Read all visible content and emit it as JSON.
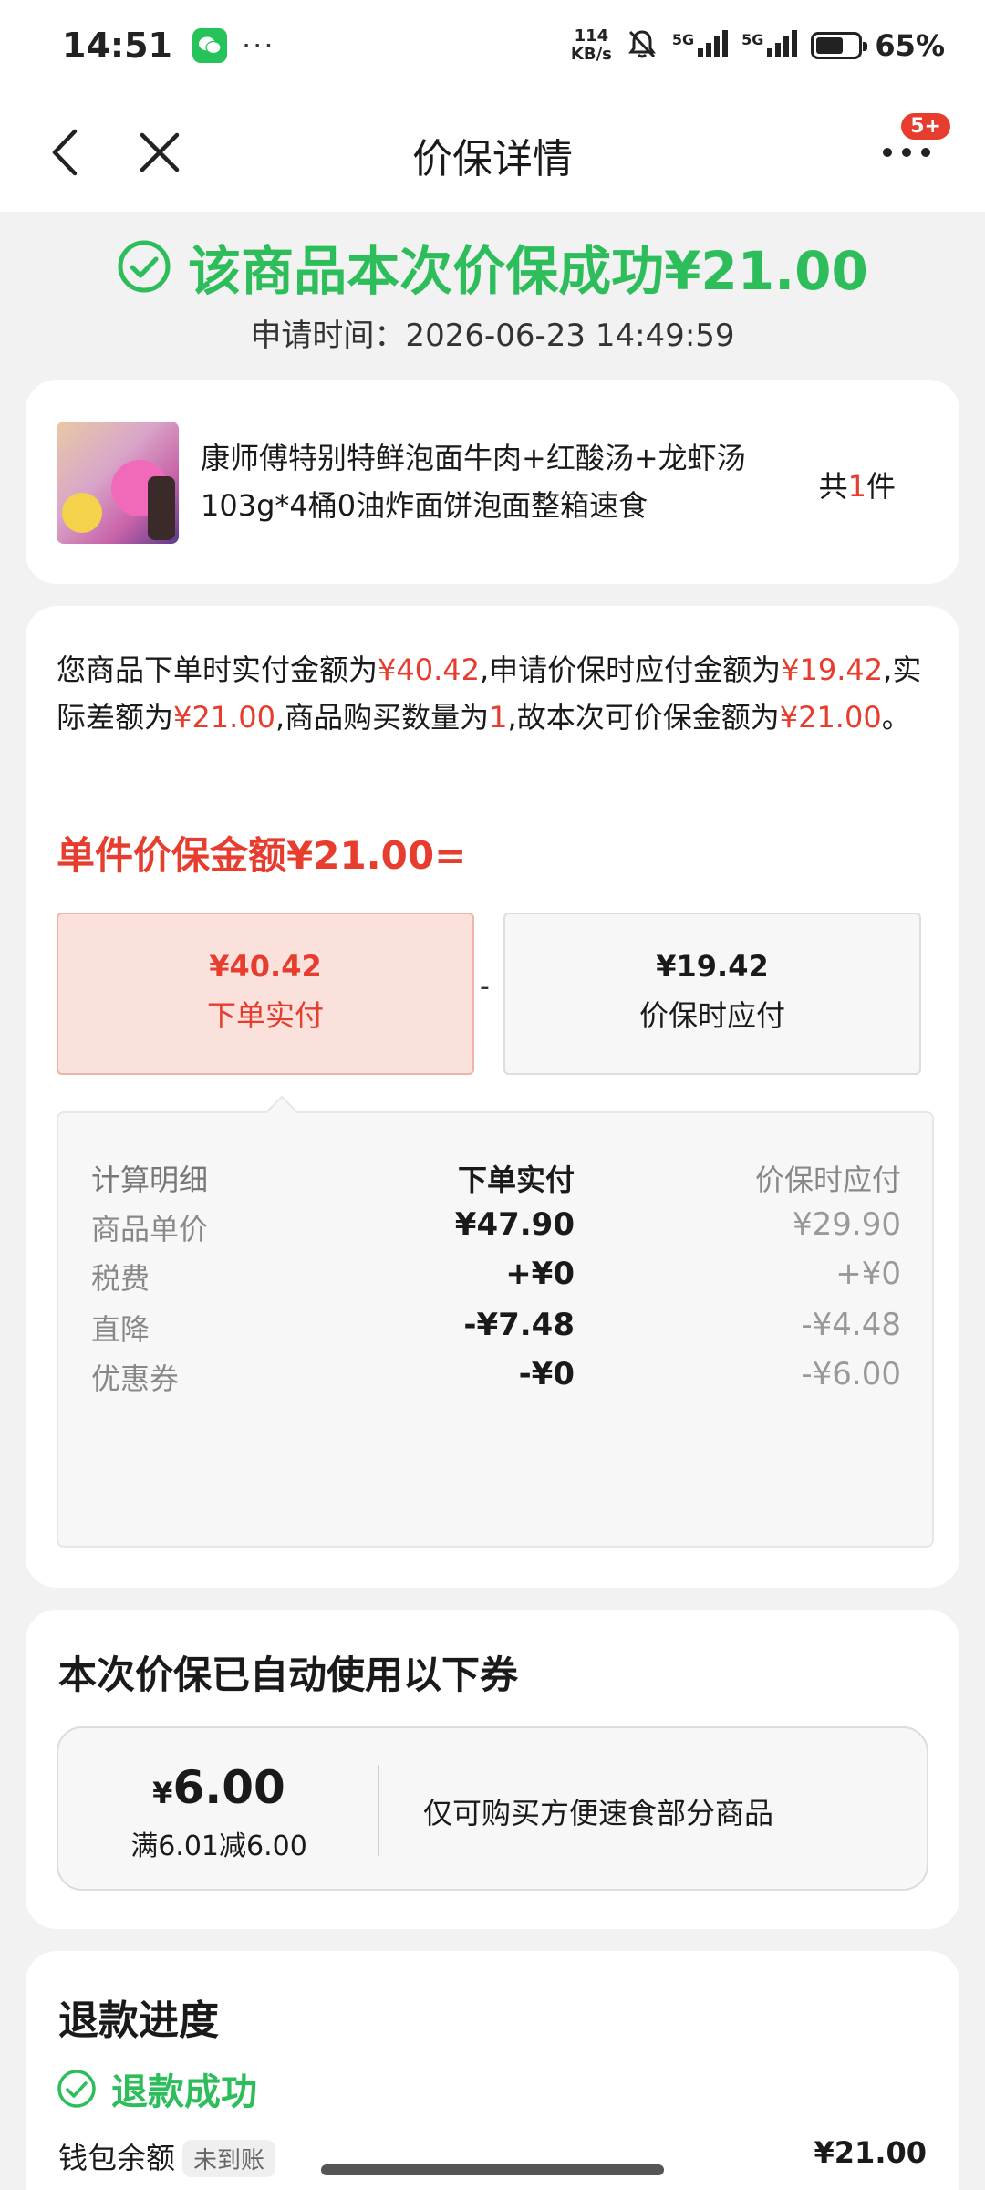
{
  "status_bar": {
    "time": "14:51",
    "more": "···",
    "net_speed_value": "114",
    "net_speed_unit": "KB/s",
    "signal1": "5G",
    "signal2": "5G",
    "battery_level": 0.65,
    "battery": "65%"
  },
  "nav": {
    "title": "价保详情",
    "badge": "5+"
  },
  "header": {
    "success": "该商品本次价保成功¥21.00",
    "apply_time": "申请时间：2026-06-23 14:49:59"
  },
  "product": {
    "name": "康师傅特别特鲜泡面牛肉+红酸汤+龙虾汤103g*4桶0油炸面饼泡面整箱速食",
    "qty_prefix": "共",
    "qty": "1",
    "qty_suffix": "件"
  },
  "detail": {
    "desc_1": "您商品下单时实付金额为",
    "paid": "¥40.42",
    "desc_2": ",申请价保时应付金额为",
    "protect_pay": "¥19.42",
    "desc_3": ",实际差额为",
    "diff": "¥21.00",
    "desc_4": ",商品购买数量为",
    "qty": "1",
    "desc_5": ",故本次可价保金额为",
    "total": "¥21.00",
    "desc_6": "。",
    "unit_title": "单件价保金额¥21.00=",
    "box_pay_amount": "¥40.42",
    "box_pay_label": "下单实付",
    "minus": "-",
    "box_protect_amount": "¥19.42",
    "box_protect_label": "价保时应付",
    "calc_headers": [
      "计算明细",
      "下单实付",
      "价保时应付"
    ],
    "calc_rows": [
      [
        "商品单价",
        "¥47.90",
        "¥29.90"
      ],
      [
        "税费",
        "+¥0",
        "+¥0"
      ],
      [
        "直降",
        "-¥7.48",
        "-¥4.48"
      ],
      [
        "优惠券",
        "-¥0",
        "-¥6.00"
      ]
    ]
  },
  "coupon": {
    "title": "本次价保已自动使用以下券",
    "yen": "¥",
    "amount": "6.00",
    "condition": "满6.01减6.00",
    "desc": "仅可购买方便速食部分商品"
  },
  "refund": {
    "title": "退款进度",
    "status": "退款成功",
    "row_label": "钱包余额",
    "row_tag": "未到账",
    "row_amount": "¥21.00"
  },
  "colors": {
    "success_green": "#2dbd5b",
    "price_red": "#e63d2e",
    "page_bg": "#f2f2f2"
  }
}
